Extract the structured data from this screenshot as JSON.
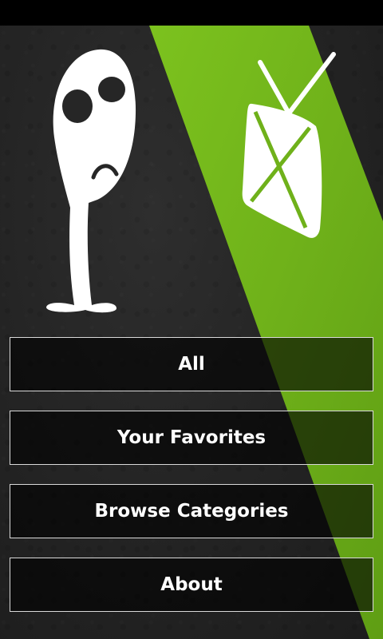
{
  "colors": {
    "background": "#262626",
    "accent_green": "#6fb11a",
    "button_border": "#d9d9d9",
    "button_text": "#ffffff"
  },
  "illustration": {
    "characters": [
      "sad-alien-icon",
      "tv-icon"
    ]
  },
  "menu": {
    "items": [
      {
        "label": "All"
      },
      {
        "label": "Your Favorites"
      },
      {
        "label": "Browse Categories"
      },
      {
        "label": "About"
      }
    ]
  }
}
